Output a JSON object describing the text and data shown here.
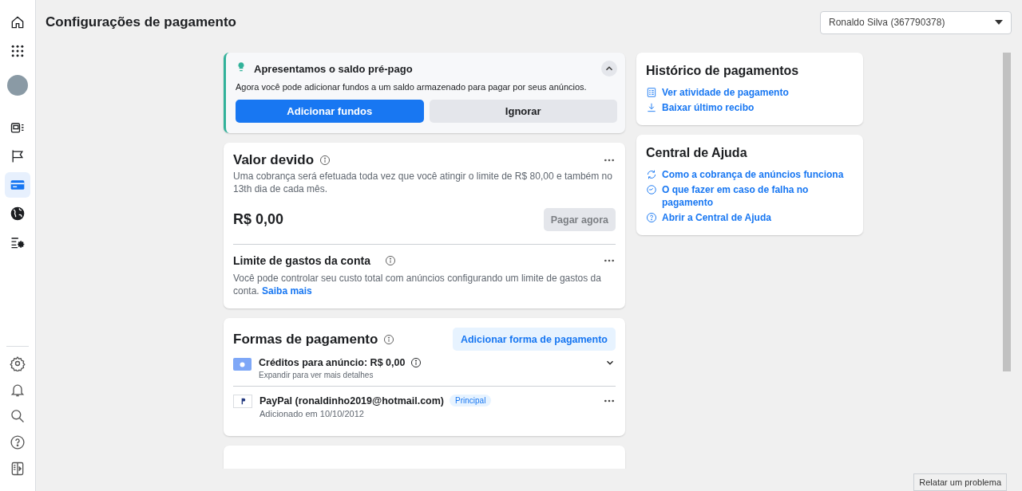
{
  "header": {
    "title": "Configurações de pagamento",
    "account_select": {
      "value": "Ronaldo Silva (367790378)"
    }
  },
  "sidebar": {
    "top_items": [
      {
        "selected": false
      },
      {
        "selected": false
      }
    ],
    "nav_items": [
      {
        "selected": false
      },
      {
        "selected": false
      },
      {
        "selected": true
      },
      {
        "selected": false
      },
      {
        "selected": false
      }
    ],
    "bottom_items": [
      {
        "selected": false
      },
      {
        "selected": false
      },
      {
        "selected": false
      },
      {
        "selected": false
      },
      {
        "selected": false
      }
    ]
  },
  "promo": {
    "title": "Apresentamos o saldo pré-pago",
    "text": "Agora você pode adicionar fundos a um saldo armazenado para pagar por seus anúncios.",
    "expanded": true,
    "buttons": [
      {
        "label": "Adicionar fundos",
        "kind": "primary"
      },
      {
        "label": "Ignorar",
        "kind": "secondary"
      }
    ]
  },
  "amount_due": {
    "title": "Valor devido",
    "description": "Uma cobrança será efetuada toda vez que você atingir o limite de R$ 80,00 e também no 13th dia de cada mês.",
    "amount": "R$ 0,00",
    "pay_button": {
      "label": "Pagar agora",
      "disabled": true
    }
  },
  "spending_limit": {
    "title": "Limite de gastos da conta",
    "description": "Você pode controlar seu custo total com anúncios configurando um limite de gastos da conta.",
    "link": "Saiba mais"
  },
  "payment_methods": {
    "title": "Formas de pagamento",
    "add_button": "Adicionar forma de pagamento",
    "items": [
      {
        "kind": "credits",
        "title": "Créditos para anúncio: R$ 0,00",
        "subtitle": "Expandir para ver mais detalhes",
        "expanded": false
      },
      {
        "kind": "paypal",
        "title": "PayPal (ronaldinho2019@hotmail.com)",
        "badge": "Principal",
        "subtitle": "Adicionado em 10/10/2012"
      }
    ]
  },
  "payment_history": {
    "title": "Histórico de pagamentos",
    "links": [
      {
        "kind": "activity",
        "label": "Ver atividade de pagamento"
      },
      {
        "kind": "receipt",
        "label": "Baixar último recibo"
      }
    ]
  },
  "help_center": {
    "title": "Central de Ajuda",
    "links": [
      {
        "kind": "billing",
        "label": "Como a cobrança de anúncios funciona"
      },
      {
        "kind": "failure",
        "label": "O que fazer em caso de falha no pagamento"
      },
      {
        "kind": "help",
        "label": "Abrir a Central de Ajuda"
      }
    ]
  },
  "report_button": "Relatar um problema"
}
